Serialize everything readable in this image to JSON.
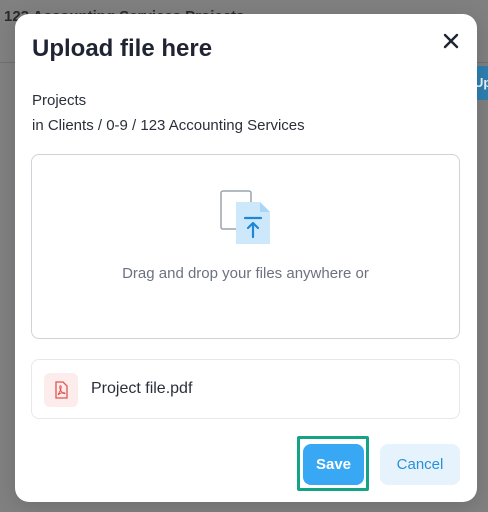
{
  "background": {
    "header_text": "123 Accounting Services Projects",
    "side_button_label": "Up"
  },
  "modal": {
    "title": "Upload file here",
    "field_label": "Projects",
    "field_path": "in Clients / 0-9 / 123 Accounting Services",
    "dropzone": {
      "text": "Drag and drop your files anywhere or",
      "icon": "file-upload-icon"
    },
    "file": {
      "name": "Project file.pdf",
      "icon": "pdf-icon"
    },
    "buttons": {
      "save": "Save",
      "cancel": "Cancel"
    },
    "close_icon": "close-icon"
  },
  "colors": {
    "accent": "#38a8f5",
    "cancel_bg": "#e6f3fc",
    "highlight_outline": "#14a383",
    "pdf": "#e0554f"
  }
}
